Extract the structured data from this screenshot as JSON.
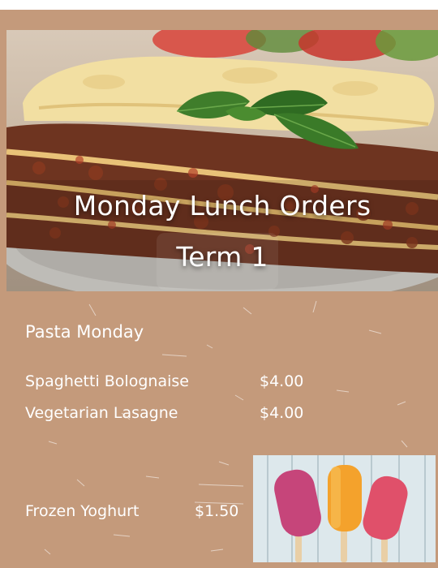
{
  "hero": {
    "title_line1": "Monday Lunch Orders",
    "title_line2": "Term 1"
  },
  "section": {
    "title": "Pasta Monday"
  },
  "menu_items": [
    {
      "name": "Spaghetti Bolognaise",
      "price": "$4.00"
    },
    {
      "name": "Vegetarian Lasagne",
      "price": "$4.00"
    }
  ],
  "dessert": {
    "name": "Frozen Yoghurt",
    "price": "$1.50"
  },
  "colors": {
    "background": "#c49a7b",
    "text": "#ffffff",
    "popsicle_pink": "#c6457a",
    "popsicle_orange": "#f4a22c",
    "popsicle_red": "#e0506a"
  },
  "images": {
    "hero_photo": "lasagne-photo",
    "side_photo": "popsicles-photo"
  }
}
